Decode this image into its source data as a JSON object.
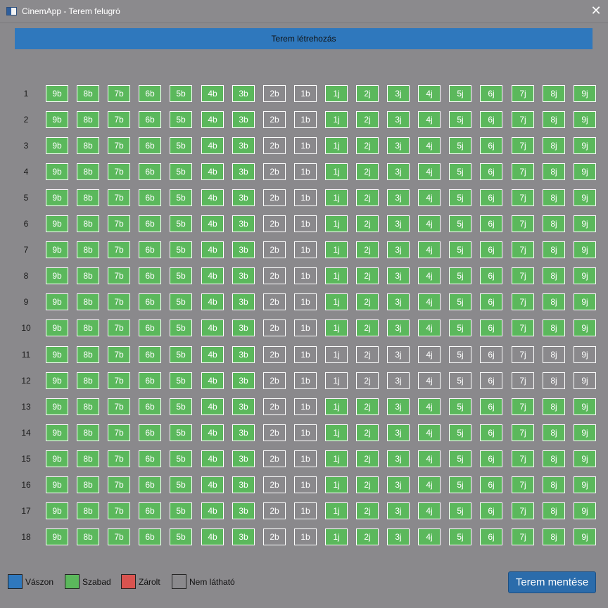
{
  "window": {
    "title": "CinemApp - Terem felugró",
    "close_glyph": "✕",
    "icon": "app-window-icon"
  },
  "header": {
    "title": "Terem létrehozás"
  },
  "seat_grid": {
    "columns": [
      "9b",
      "8b",
      "7b",
      "6b",
      "5b",
      "4b",
      "3b",
      "2b",
      "1b",
      "1j",
      "2j",
      "3j",
      "4j",
      "5j",
      "6j",
      "7j",
      "8j",
      "9j"
    ],
    "rows": [
      {
        "label": "1",
        "states": [
          "free",
          "free",
          "free",
          "free",
          "free",
          "free",
          "free",
          "hidden",
          "hidden",
          "free",
          "free",
          "free",
          "free",
          "free",
          "free",
          "free",
          "free",
          "free"
        ]
      },
      {
        "label": "2",
        "states": [
          "free",
          "free",
          "free",
          "free",
          "free",
          "free",
          "free",
          "hidden",
          "hidden",
          "free",
          "free",
          "free",
          "free",
          "free",
          "free",
          "free",
          "free",
          "free"
        ]
      },
      {
        "label": "3",
        "states": [
          "free",
          "free",
          "free",
          "free",
          "free",
          "free",
          "free",
          "hidden",
          "hidden",
          "free",
          "free",
          "free",
          "free",
          "free",
          "free",
          "free",
          "free",
          "free"
        ]
      },
      {
        "label": "4",
        "states": [
          "free",
          "free",
          "free",
          "free",
          "free",
          "free",
          "free",
          "hidden",
          "hidden",
          "free",
          "free",
          "free",
          "free",
          "free",
          "free",
          "free",
          "free",
          "free"
        ]
      },
      {
        "label": "5",
        "states": [
          "free",
          "free",
          "free",
          "free",
          "free",
          "free",
          "free",
          "hidden",
          "hidden",
          "free",
          "free",
          "free",
          "free",
          "free",
          "free",
          "free",
          "free",
          "free"
        ]
      },
      {
        "label": "6",
        "states": [
          "free",
          "free",
          "free",
          "free",
          "free",
          "free",
          "free",
          "hidden",
          "hidden",
          "free",
          "free",
          "free",
          "free",
          "free",
          "free",
          "free",
          "free",
          "free"
        ]
      },
      {
        "label": "7",
        "states": [
          "free",
          "free",
          "free",
          "free",
          "free",
          "free",
          "free",
          "hidden",
          "hidden",
          "free",
          "free",
          "free",
          "free",
          "free",
          "free",
          "free",
          "free",
          "free"
        ]
      },
      {
        "label": "8",
        "states": [
          "free",
          "free",
          "free",
          "free",
          "free",
          "free",
          "free",
          "hidden",
          "hidden",
          "free",
          "free",
          "free",
          "free",
          "free",
          "free",
          "free",
          "free",
          "free"
        ]
      },
      {
        "label": "9",
        "states": [
          "free",
          "free",
          "free",
          "free",
          "free",
          "free",
          "free",
          "hidden",
          "hidden",
          "free",
          "free",
          "free",
          "free",
          "free",
          "free",
          "free",
          "free",
          "free"
        ]
      },
      {
        "label": "10",
        "states": [
          "free",
          "free",
          "free",
          "free",
          "free",
          "free",
          "free",
          "hidden",
          "hidden",
          "free",
          "free",
          "free",
          "free",
          "free",
          "free",
          "free",
          "free",
          "free"
        ]
      },
      {
        "label": "11",
        "states": [
          "free",
          "free",
          "free",
          "free",
          "free",
          "free",
          "free",
          "hidden",
          "hidden",
          "hidden",
          "hidden",
          "hidden",
          "hidden",
          "hidden",
          "hidden",
          "hidden",
          "hidden",
          "hidden"
        ]
      },
      {
        "label": "12",
        "states": [
          "free",
          "free",
          "free",
          "free",
          "free",
          "free",
          "free",
          "hidden",
          "hidden",
          "hidden",
          "hidden",
          "hidden",
          "hidden",
          "hidden",
          "hidden",
          "hidden",
          "hidden",
          "hidden"
        ]
      },
      {
        "label": "13",
        "states": [
          "free",
          "free",
          "free",
          "free",
          "free",
          "free",
          "free",
          "hidden",
          "hidden",
          "free",
          "free",
          "free",
          "free",
          "free",
          "free",
          "free",
          "free",
          "free"
        ]
      },
      {
        "label": "14",
        "states": [
          "free",
          "free",
          "free",
          "free",
          "free",
          "free",
          "free",
          "hidden",
          "hidden",
          "free",
          "free",
          "free",
          "free",
          "free",
          "free",
          "free",
          "free",
          "free"
        ]
      },
      {
        "label": "15",
        "states": [
          "free",
          "free",
          "free",
          "free",
          "free",
          "free",
          "free",
          "hidden",
          "hidden",
          "free",
          "free",
          "free",
          "free",
          "free",
          "free",
          "free",
          "free",
          "free"
        ]
      },
      {
        "label": "16",
        "states": [
          "free",
          "free",
          "free",
          "free",
          "free",
          "free",
          "free",
          "hidden",
          "hidden",
          "free",
          "free",
          "free",
          "free",
          "free",
          "free",
          "free",
          "free",
          "free"
        ]
      },
      {
        "label": "17",
        "states": [
          "free",
          "free",
          "free",
          "free",
          "free",
          "free",
          "free",
          "hidden",
          "hidden",
          "free",
          "free",
          "free",
          "free",
          "free",
          "free",
          "free",
          "free",
          "free"
        ]
      },
      {
        "label": "18",
        "states": [
          "free",
          "free",
          "free",
          "free",
          "free",
          "free",
          "free",
          "hidden",
          "hidden",
          "free",
          "free",
          "free",
          "free",
          "free",
          "free",
          "free",
          "free",
          "free"
        ]
      }
    ]
  },
  "legend": {
    "items": [
      {
        "label": "Vászon",
        "color": "#2f78bd"
      },
      {
        "label": "Szabad",
        "color": "#5bb85c"
      },
      {
        "label": "Zárolt",
        "color": "#d9534f"
      },
      {
        "label": "Nem látható",
        "color": "#8a898c"
      }
    ]
  },
  "footer": {
    "save_label": "Terem mentése"
  },
  "colors": {
    "screen": "#2f78bd",
    "free": "#5bb85c",
    "locked": "#d9534f",
    "hidden": "#8a898c",
    "background": "#8a898c"
  }
}
